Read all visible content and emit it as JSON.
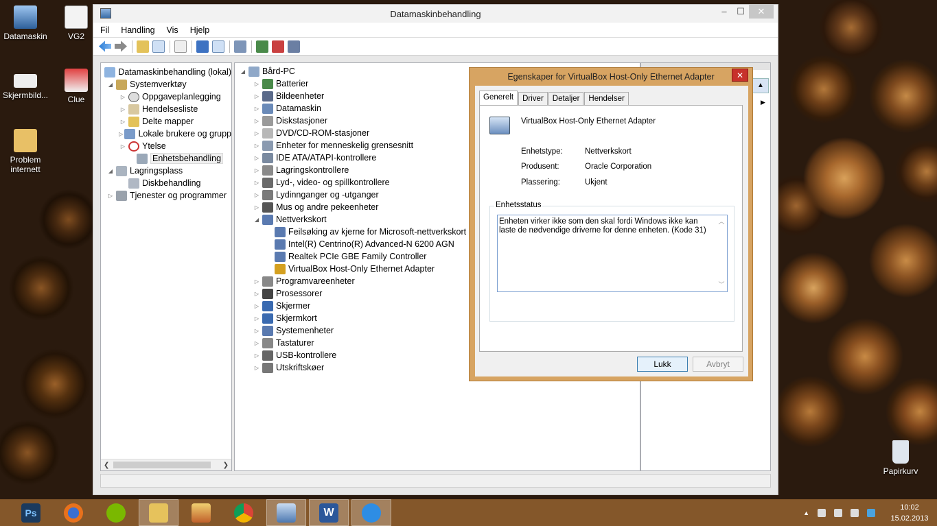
{
  "desktop": {
    "icons": [
      {
        "label": "Datamaskin"
      },
      {
        "label": "VG2"
      },
      {
        "label": "Skjermbild..."
      },
      {
        "label": "Clue"
      },
      {
        "label": "Problem internett"
      },
      {
        "label": "Papirkurv"
      }
    ]
  },
  "window": {
    "title": "Datamaskinbehandling",
    "controls": {
      "minimize": "–",
      "maximize": "☐",
      "close": "✕"
    },
    "menu": [
      "Fil",
      "Handling",
      "Vis",
      "Hjelp"
    ]
  },
  "tree": {
    "items": [
      {
        "label": "Datamaskinbehandling (lokal)",
        "arrow": ""
      },
      {
        "label": "Systemverktøy",
        "arrow": "◢"
      },
      {
        "label": "Oppgaveplanlegging",
        "arrow": "▷"
      },
      {
        "label": "Hendelsesliste",
        "arrow": "▷"
      },
      {
        "label": "Delte mapper",
        "arrow": "▷"
      },
      {
        "label": "Lokale brukere og grupp",
        "arrow": "▷"
      },
      {
        "label": "Ytelse",
        "arrow": "▷"
      },
      {
        "label": "Enhetsbehandling",
        "arrow": ""
      },
      {
        "label": "Lagringsplass",
        "arrow": "◢"
      },
      {
        "label": "Diskbehandling",
        "arrow": ""
      },
      {
        "label": "Tjenester og programmer",
        "arrow": "▷"
      }
    ]
  },
  "devices": {
    "root": "Bård-PC",
    "items": [
      {
        "label": "Batterier",
        "arrow": "▷"
      },
      {
        "label": "Bildeenheter",
        "arrow": "▷"
      },
      {
        "label": "Datamaskin",
        "arrow": "▷"
      },
      {
        "label": "Diskstasjoner",
        "arrow": "▷"
      },
      {
        "label": "DVD/CD-ROM-stasjoner",
        "arrow": "▷"
      },
      {
        "label": "Enheter for menneskelig grensesnitt",
        "arrow": "▷"
      },
      {
        "label": "IDE ATA/ATAPI-kontrollere",
        "arrow": "▷"
      },
      {
        "label": "Lagringskontrollere",
        "arrow": "▷"
      },
      {
        "label": "Lyd-, video- og spillkontrollere",
        "arrow": "▷"
      },
      {
        "label": "Lydinnganger og -utganger",
        "arrow": "▷"
      },
      {
        "label": "Mus og andre pekeenheter",
        "arrow": "▷"
      },
      {
        "label": "Nettverkskort",
        "arrow": "◢"
      },
      {
        "label": "Feilsøking av kjerne for Microsoft-nettverkskort",
        "arrow": ""
      },
      {
        "label": "Intel(R) Centrino(R) Advanced-N 6200 AGN",
        "arrow": ""
      },
      {
        "label": "Realtek PCIe GBE Family Controller",
        "arrow": ""
      },
      {
        "label": "VirtualBox Host-Only Ethernet Adapter",
        "arrow": ""
      },
      {
        "label": "Programvareenheter",
        "arrow": "▷"
      },
      {
        "label": "Prosessorer",
        "arrow": "▷"
      },
      {
        "label": "Skjermer",
        "arrow": "▷"
      },
      {
        "label": "Skjermkort",
        "arrow": "▷"
      },
      {
        "label": "Systemenheter",
        "arrow": "▷"
      },
      {
        "label": "Tastaturer",
        "arrow": "▷"
      },
      {
        "label": "USB-kontrollere",
        "arrow": "▷"
      },
      {
        "label": "Utskriftskøer",
        "arrow": "▷"
      }
    ]
  },
  "dialog": {
    "title": "Egenskaper for VirtualBox Host-Only Ethernet Adapter",
    "close": "✕",
    "tabs": [
      "Generelt",
      "Driver",
      "Detaljer",
      "Hendelser"
    ],
    "device_name": "VirtualBox Host-Only Ethernet Adapter",
    "props": [
      {
        "key": "Enhetstype:",
        "value": "Nettverkskort"
      },
      {
        "key": "Produsent:",
        "value": "Oracle Corporation"
      },
      {
        "key": "Plassering:",
        "value": "Ukjent"
      }
    ],
    "status_label": "Enhetsstatus",
    "status_text": "Enheten virker ikke som den skal fordi Windows ikke kan laste de nødvendige driverne for denne enheten. (Kode 31)",
    "ok": "Lukk",
    "cancel": "Avbryt"
  },
  "tray": {
    "time": "10:02",
    "date": "15.02.2013"
  }
}
